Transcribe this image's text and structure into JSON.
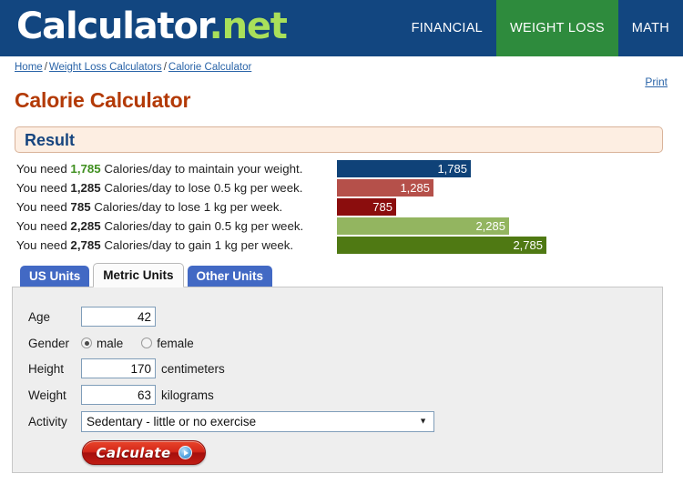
{
  "header": {
    "logo_white": "Calculator",
    "logo_dot": ".",
    "logo_green": "net",
    "nav": [
      {
        "label": "FINANCIAL",
        "active": false
      },
      {
        "label": "WEIGHT LOSS",
        "active": true
      },
      {
        "label": "MATH",
        "active": false
      }
    ],
    "colors": {
      "bar": "#124680",
      "active_tab": "#2e8b3d",
      "accent_green": "#a9e05a"
    }
  },
  "breadcrumb": {
    "items": [
      "Home",
      "Weight Loss Calculators",
      "Calorie Calculator"
    ],
    "separator": "/"
  },
  "print_label": "Print",
  "page_title": "Calorie Calculator",
  "result": {
    "heading": "Result",
    "rows": [
      {
        "prefix": "You need ",
        "value": "1,785",
        "suffix": " Calories/day to maintain your weight.",
        "bar_label": "1,785",
        "bar_color": "#0f4278",
        "highlight": true
      },
      {
        "prefix": "You need ",
        "value": "1,285",
        "suffix": " Calories/day to lose 0.5 kg per week.",
        "bar_label": "1,285",
        "bar_color": "#b5504a",
        "highlight": false
      },
      {
        "prefix": "You need ",
        "value": "785",
        "suffix": " Calories/day to lose 1 kg per week.",
        "bar_label": "785",
        "bar_color": "#8b0d0d",
        "highlight": false
      },
      {
        "prefix": "You need ",
        "value": "2,285",
        "suffix": " Calories/day to gain 0.5 kg per week.",
        "bar_label": "2,285",
        "bar_color": "#93b560",
        "highlight": false
      },
      {
        "prefix": "You need ",
        "value": "2,785",
        "suffix": " Calories/day to gain 1 kg per week.",
        "bar_label": "2,785",
        "bar_color": "#4f7913",
        "highlight": false
      }
    ]
  },
  "chart_data": {
    "type": "bar",
    "title": "Result",
    "categories": [
      "maintain your weight",
      "lose 0.5 kg per week",
      "lose 1 kg per week",
      "gain 0.5 kg per week",
      "gain 1 kg per week"
    ],
    "values": [
      1785,
      1285,
      785,
      2285,
      2785
    ],
    "labels": [
      "1,785",
      "1,285",
      "785",
      "2,285",
      "2,785"
    ],
    "colors": [
      "#0f4278",
      "#b5504a",
      "#8b0d0d",
      "#93b560",
      "#4f7913"
    ],
    "xlabel": "Calories/day",
    "ylabel": "",
    "xlim": [
      0,
      2785
    ],
    "grid": false,
    "legend": "none",
    "orientation": "horizontal"
  },
  "tabs": [
    {
      "label": "US Units",
      "active": false
    },
    {
      "label": "Metric Units",
      "active": true
    },
    {
      "label": "Other Units",
      "active": false
    }
  ],
  "form": {
    "age": {
      "label": "Age",
      "value": "42",
      "unit": ""
    },
    "gender": {
      "label": "Gender",
      "options": [
        {
          "label": "male",
          "selected": true
        },
        {
          "label": "female",
          "selected": false
        }
      ]
    },
    "height": {
      "label": "Height",
      "value": "170",
      "unit": "centimeters"
    },
    "weight": {
      "label": "Weight",
      "value": "63",
      "unit": "kilograms"
    },
    "activity": {
      "label": "Activity",
      "value": "Sedentary - little or no exercise",
      "arrow": "▼"
    },
    "calculate_label": "Calculate"
  }
}
